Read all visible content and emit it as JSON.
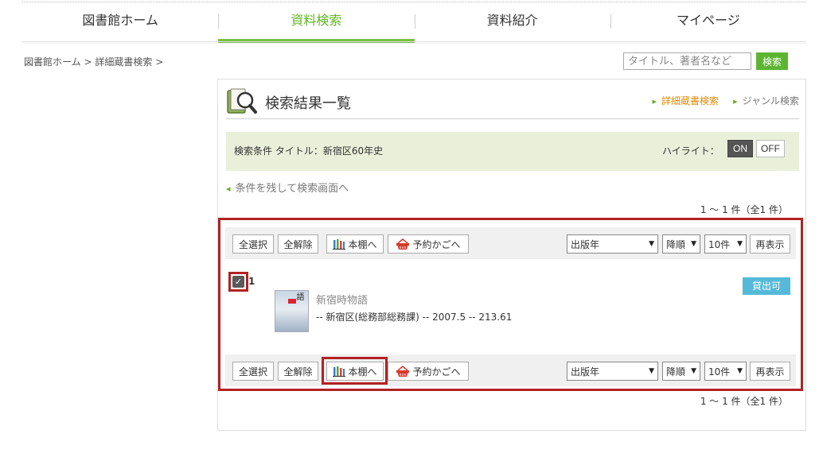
{
  "nav": {
    "items": [
      {
        "label": "図書館ホーム",
        "active": false
      },
      {
        "label": "資料検索",
        "active": true
      },
      {
        "label": "資料紹介",
        "active": false
      },
      {
        "label": "マイページ",
        "active": false
      }
    ]
  },
  "breadcrumb": {
    "home": "図書館ホーム",
    "sep": ">",
    "current": "詳細蔵書検索"
  },
  "search": {
    "placeholder": "タイトル、著者名など",
    "button_label": "検索"
  },
  "panel": {
    "title": "検索結果一覧",
    "link_detail": "詳細蔵書検索",
    "link_genre": "ジャンル検索"
  },
  "conditions": {
    "text": "検索条件  タイトル：新宿区60年史",
    "highlight_label": "ハイライト：",
    "on_label": "ON",
    "off_label": "OFF"
  },
  "back_link": "条件を残して検索画面へ",
  "count_text": "1 ～ 1 件（全1 件）",
  "toolbar": {
    "select_all": "全選択",
    "deselect_all": "全解除",
    "bookshelf": "本棚へ",
    "reserve_cart": "予約かごへ",
    "sort_field": "出版年",
    "sort_order": "降順",
    "per_page": "10件",
    "redisplay": "再表示"
  },
  "record": {
    "number": "1",
    "checked": true,
    "title": "新宿時物語",
    "meta": "-- 新宿区(総務部総務課) -- 2007.5 -- 213.61",
    "status": "貸出可",
    "cover_text": "新宿時物語"
  },
  "colors": {
    "accent_green": "#7ac143",
    "search_button": "#5cb531",
    "highlight_red": "#b22222",
    "status_badge": "#56b9d9",
    "condition_bg": "#eaefd9"
  },
  "icons": {
    "panel": "book-search-icon",
    "bookshelf": "bar-chart-books-icon",
    "cart": "basket-icon"
  }
}
